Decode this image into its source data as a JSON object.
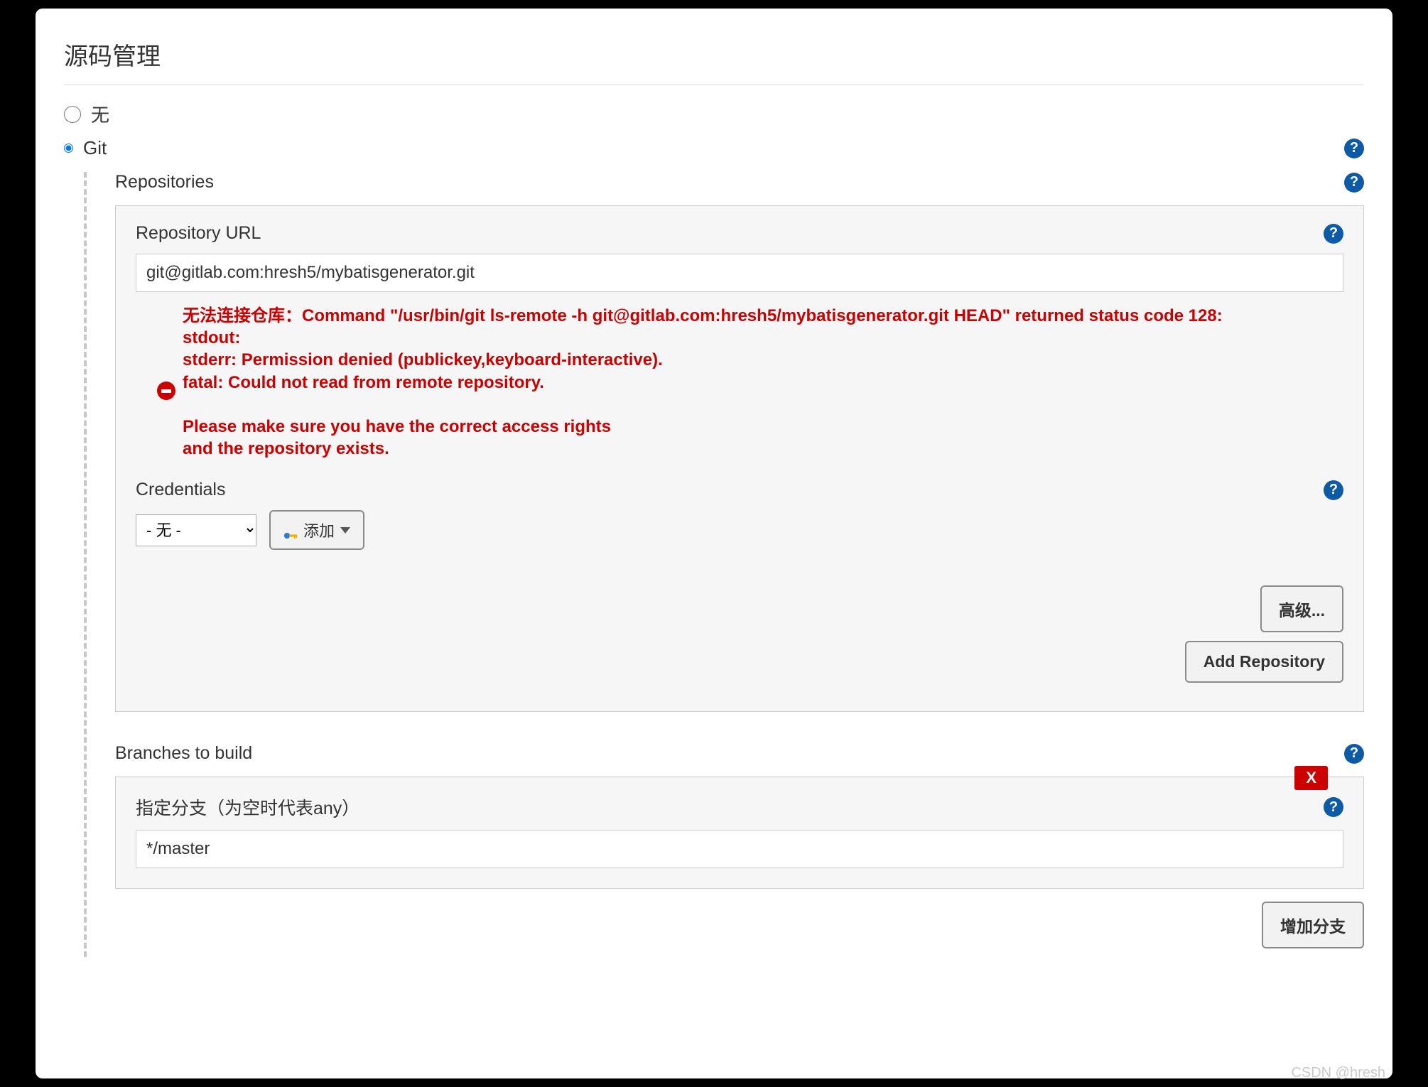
{
  "section_title": "源码管理",
  "scm": {
    "none_label": "无",
    "git_label": "Git",
    "none_checked": false,
    "git_checked": true
  },
  "repositories": {
    "header": "Repositories",
    "url_label": "Repository URL",
    "url_value": "git@gitlab.com:hresh5/mybatisgenerator.git",
    "error_text": "无法连接仓库：Command \"/usr/bin/git ls-remote -h git@gitlab.com:hresh5/mybatisgenerator.git HEAD\" returned status code 128:\nstdout:\nstderr: Permission denied (publickey,keyboard-interactive).\nfatal: Could not read from remote repository.\n\nPlease make sure you have the correct access rights\nand the repository exists.",
    "credentials_label": "Credentials",
    "credentials_selected": "- 无 -",
    "add_button": "添加",
    "advanced_button": "高级...",
    "add_repo_button": "Add Repository"
  },
  "branches": {
    "header": "Branches to build",
    "specifier_label": "指定分支（为空时代表any）",
    "specifier_value": "*/master",
    "delete_label": "X",
    "add_branch_button": "增加分支"
  },
  "help_glyph": "?",
  "watermark": "CSDN @hresh"
}
